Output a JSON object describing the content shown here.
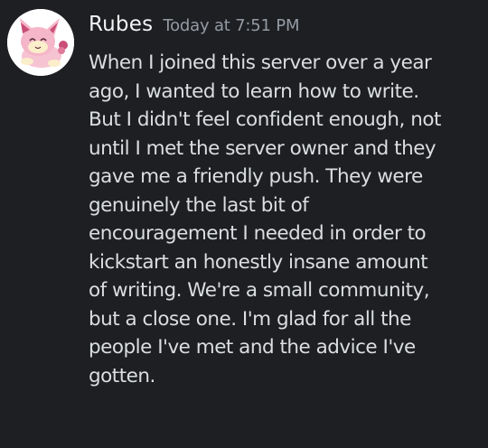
{
  "message": {
    "author": "Rubes",
    "timestamp": "Today at 7:51 PM",
    "avatar_icon": "skitty-pokemon-avatar-icon",
    "lines": [
      "When I joined this server over a year",
      "ago, I wanted to learn how to write.",
      "But I didn't feel confident enough, not",
      "until I met the server owner and they",
      "gave me a friendly push. They were",
      "genuinely the last bit of",
      "encouragement I needed in order to",
      "kickstart an honestly insane amount",
      "of writing. We're a small community,",
      "but a close one. I'm glad for all the",
      "people I've met and the advice I've",
      "gotten."
    ]
  },
  "colors": {
    "background": "#1e1f22",
    "username": "#f2f3f5",
    "timestamp": "#949ba4",
    "text": "#dbdee1"
  }
}
